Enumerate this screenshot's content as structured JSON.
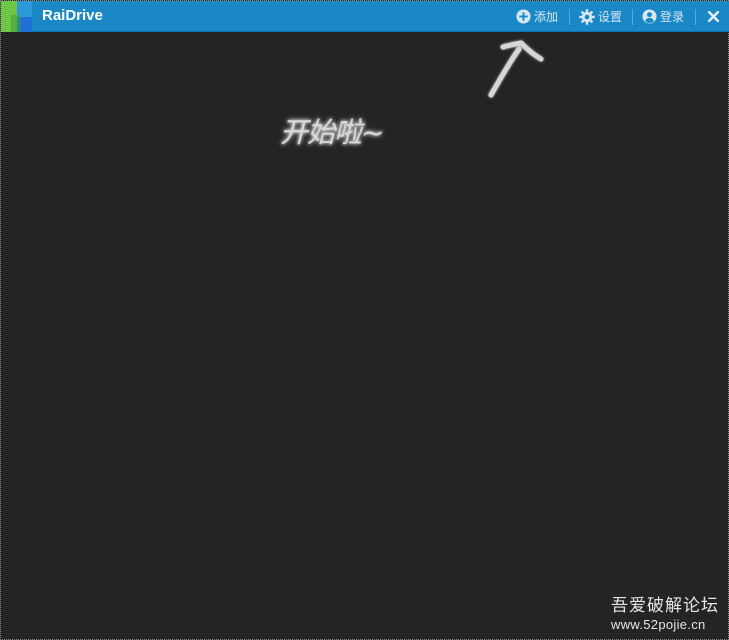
{
  "window": {
    "title": "RaiDrive"
  },
  "titlebar": {
    "buttons": {
      "add": {
        "label": "添加",
        "icon": "plus-circle-icon"
      },
      "settings": {
        "label": "设置",
        "icon": "gear-icon"
      },
      "login": {
        "label": "登录",
        "icon": "user-circle-icon"
      },
      "close": {
        "icon": "close-icon"
      }
    }
  },
  "main": {
    "hint_text": "开始啦~"
  },
  "watermark": {
    "name": "吾爱破解论坛",
    "url": "www.52pojie.cn"
  },
  "colors": {
    "titlebar": "#1a88c6",
    "background": "#242424",
    "logo_green": "#6cc644",
    "logo_blue": "#1e6fd9"
  }
}
